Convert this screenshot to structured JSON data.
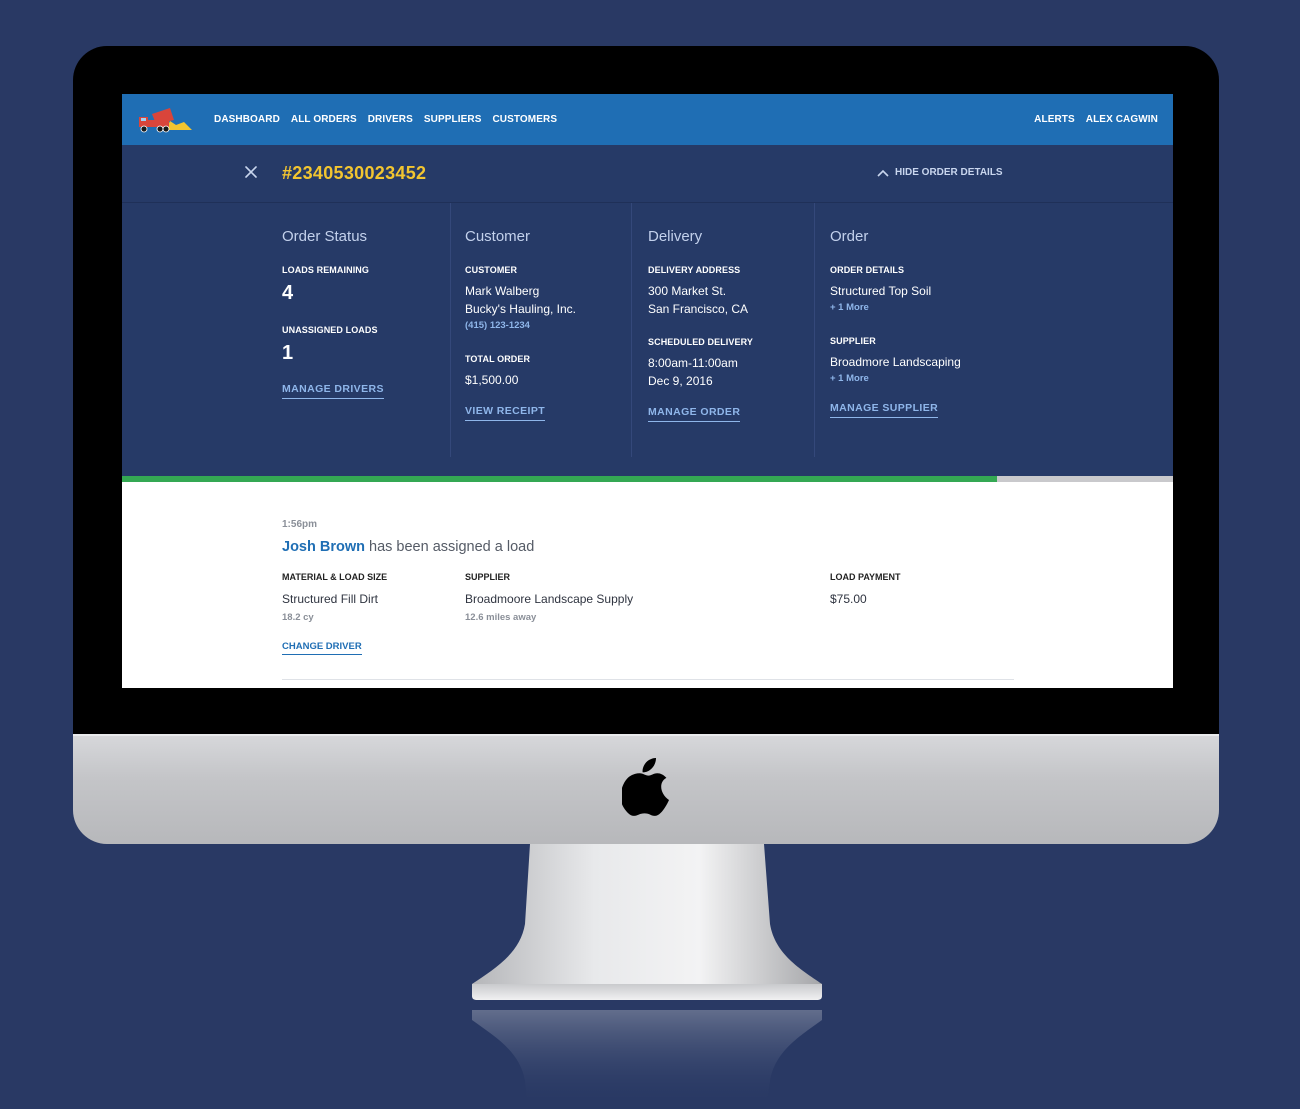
{
  "nav": {
    "links": [
      "DASHBOARD",
      "ALL ORDERS",
      "DRIVERS",
      "SUPPLIERS",
      "CUSTOMERS"
    ],
    "alerts": "ALERTS",
    "user": "ALEX CAGWIN"
  },
  "order": {
    "number": "#2340530023452",
    "hide_details": "HIDE ORDER DETAILS"
  },
  "status": {
    "title": "Order Status",
    "loads_remaining_label": "LOADS REMAINING",
    "loads_remaining": "4",
    "unassigned_label": "UNASSIGNED LOADS",
    "unassigned": "1",
    "action": "MANAGE DRIVERS"
  },
  "customer": {
    "title": "Customer",
    "label": "CUSTOMER",
    "name": "Mark Walberg",
    "company": "Bucky's Hauling, Inc.",
    "phone": "(415) 123-1234",
    "total_label": "TOTAL ORDER",
    "total": "$1,500.00",
    "action": "VIEW RECEIPT"
  },
  "delivery": {
    "title": "Delivery",
    "address_label": "DELIVERY ADDRESS",
    "address_line1": "300 Market St.",
    "address_line2": "San Francisco, CA",
    "scheduled_label": "SCHEDULED DELIVERY",
    "time": "8:00am-11:00am",
    "date": "Dec 9, 2016",
    "action": "MANAGE ORDER"
  },
  "order_col": {
    "title": "Order",
    "details_label": "ORDER DETAILS",
    "details": "Structured Top Soil",
    "details_more": "+ 1 More",
    "supplier_label": "SUPPLIER",
    "supplier": "Broadmore Landscaping",
    "supplier_more": "+ 1 More",
    "action": "MANAGE SUPPLIER"
  },
  "progress": {
    "fraction": 0.833,
    "fill_color": "#34a853"
  },
  "activity": {
    "time": "1:56pm",
    "driver": "Josh Brown",
    "message": " has been assigned a load",
    "material_label": "MATERIAL & LOAD SIZE",
    "material": "Structured Fill Dirt",
    "size": "18.2 cy",
    "supplier_label": "SUPPLIER",
    "supplier": "Broadmoore Landscape Supply",
    "distance": "12.6 miles away",
    "payment_label": "LOAD PAYMENT",
    "payment": "$75.00",
    "action": "CHANGE DRIVER"
  },
  "colors": {
    "background": "#293964",
    "nav_bar": "#1f6eb4",
    "panel": "#263a67",
    "order_number": "#f2c530",
    "link": "#8fb6ea"
  },
  "icons": [
    "truck-logo-icon",
    "close-icon",
    "chevron-up-icon",
    "apple-logo-icon"
  ]
}
